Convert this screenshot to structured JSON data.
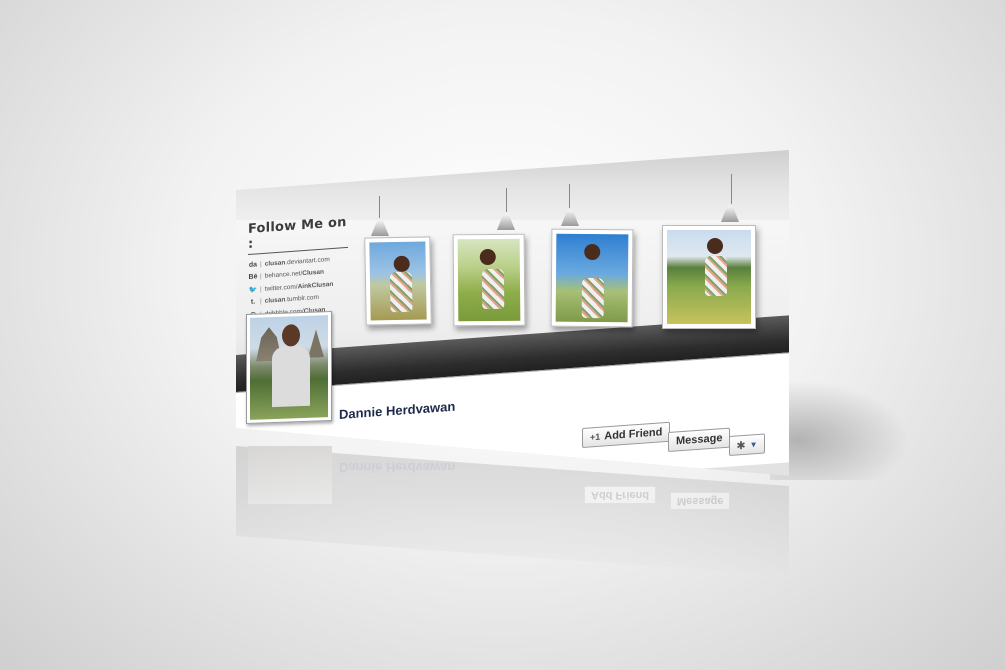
{
  "follow": {
    "title": "Follow Me on :",
    "links": [
      {
        "icon": "deviantart-icon",
        "glyph": "da",
        "prefix": "",
        "handle": "clusan",
        "suffix": ".deviantart.com"
      },
      {
        "icon": "behance-icon",
        "glyph": "Bē",
        "prefix": "behance.net/",
        "handle": "Clusan",
        "suffix": ""
      },
      {
        "icon": "twitter-icon",
        "glyph": "🐦",
        "prefix": "twitter.com/",
        "handle": "AinkClusan",
        "suffix": ""
      },
      {
        "icon": "tumblr-icon",
        "glyph": "t.",
        "prefix": "",
        "handle": "clusan",
        "suffix": ".tumblr.com"
      },
      {
        "icon": "dribbble-icon",
        "glyph": "◎",
        "prefix": "dribbble.com/",
        "handle": "Clusan",
        "suffix": ""
      }
    ]
  },
  "profile": {
    "name": "Dannie Herdvawan"
  },
  "actions": {
    "add_friend": "Add Friend",
    "add_friend_icon": "+1",
    "message": "Message",
    "gear": "✱",
    "caret": "▼"
  },
  "colors": {
    "name": "#1e2a4a",
    "accent": "#3b5998"
  }
}
